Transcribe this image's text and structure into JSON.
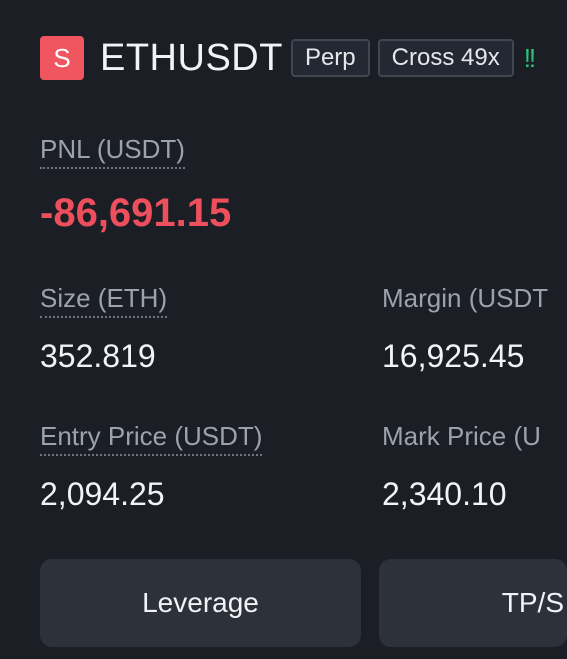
{
  "header": {
    "side_badge": "S",
    "symbol": "ETHUSDT",
    "contract_tag": "Perp",
    "margin_tag": "Cross 49x",
    "risk_indicator": "!!"
  },
  "pnl": {
    "label": "PNL (USDT)",
    "value": "-86,691.15"
  },
  "stats": {
    "size_label": "Size (ETH)",
    "size_value": "352.819",
    "margin_label": "Margin (USDT",
    "margin_value": "16,925.45",
    "entry_label": "Entry Price (USDT)",
    "entry_value": "2,094.25",
    "mark_label": "Mark Price (U",
    "mark_value": "2,340.10"
  },
  "actions": {
    "leverage_label": "Leverage",
    "tpsl_label": "TP/S"
  },
  "colors": {
    "background": "#1b1e25",
    "loss": "#ee4f5d",
    "short_badge": "#f0565f",
    "button": "#2d313a"
  }
}
